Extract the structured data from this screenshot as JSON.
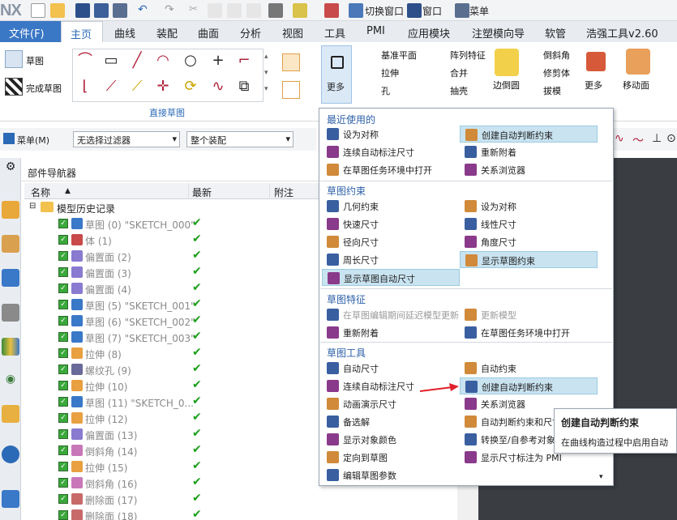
{
  "app": {
    "logo": "NX"
  },
  "qat": {
    "switch_window": "切换窗口",
    "window": "窗口",
    "menu": "菜单"
  },
  "tabs": [
    "文件(F)",
    "主页",
    "曲线",
    "装配",
    "曲面",
    "分析",
    "视图",
    "工具",
    "PMI",
    "应用模块",
    "注塑模向导",
    "软管",
    "浩强工具v2.60"
  ],
  "ribbon": {
    "sketch": "草图",
    "finish_sketch": "完成草图",
    "direct_sketch_group": "直接草图",
    "more": "更多",
    "datum_plane": "基准平面",
    "pattern_feature": "阵列特征",
    "extrude": "拉伸",
    "unite": "合并",
    "hole": "孔",
    "shell": "抽壳",
    "edge_blend": "边倒圆",
    "chamfer": "倒斜角",
    "trim_body": "修剪体",
    "draft": "拔模",
    "more2": "更多",
    "move_face": "移动面"
  },
  "cmdbar": {
    "menu": "菜单(M)",
    "filter": "无选择过滤器",
    "scope": "整个装配"
  },
  "navigator": {
    "title": "部件导航器",
    "columns": {
      "name": "名称",
      "latest": "最新",
      "note": "附注"
    },
    "root": "模型历史记录",
    "rows": [
      "草图 (0) \"SKETCH_000\"",
      "体 (1)",
      "偏置面 (2)",
      "偏置面 (3)",
      "偏置面 (4)",
      "草图 (5) \"SKETCH_001\"",
      "草图 (6) \"SKETCH_002\"",
      "草图 (7) \"SKETCH_003\"",
      "拉伸 (8)",
      "螺纹孔 (9)",
      "拉伸 (10)",
      "草图 (11) \"SKETCH_0...",
      "拉伸 (12)",
      "偏置面 (13)",
      "倒斜角 (14)",
      "拉伸 (15)",
      "倒斜角 (16)",
      "删除面 (17)",
      "删除面 (18)"
    ]
  },
  "menu": {
    "recent_title": "最近使用的",
    "recent": [
      "设为对称",
      "创建自动判断约束",
      "连续自动标注尺寸",
      "重新附着",
      "在草图任务环境中打开",
      "关系浏览器"
    ],
    "constraints_title": "草图约束",
    "constraints": [
      "几何约束",
      "设为对称",
      "快速尺寸",
      "线性尺寸",
      "径向尺寸",
      "角度尺寸",
      "周长尺寸",
      "显示草图约束",
      "显示草图自动尺寸"
    ],
    "features_title": "草图特征",
    "features": [
      "在草图编辑期间延迟模型更新",
      "更新模型",
      "重新附着",
      "在草图任务环境中打开"
    ],
    "tools_title": "草图工具",
    "tools": [
      "自动尺寸",
      "自动约束",
      "连续自动标注尺寸",
      "创建自动判断约束",
      "动画演示尺寸",
      "关系浏览器",
      "备选解",
      "自动判断约束和尺寸",
      "显示对象颜色",
      "转换至/自参考对象",
      "定向到草图",
      "显示尺寸标注为 PMI",
      "编辑草图参数"
    ]
  },
  "tooltip": {
    "title": "创建自动判断约束",
    "desc": "在曲线构造过程中启用自动"
  }
}
